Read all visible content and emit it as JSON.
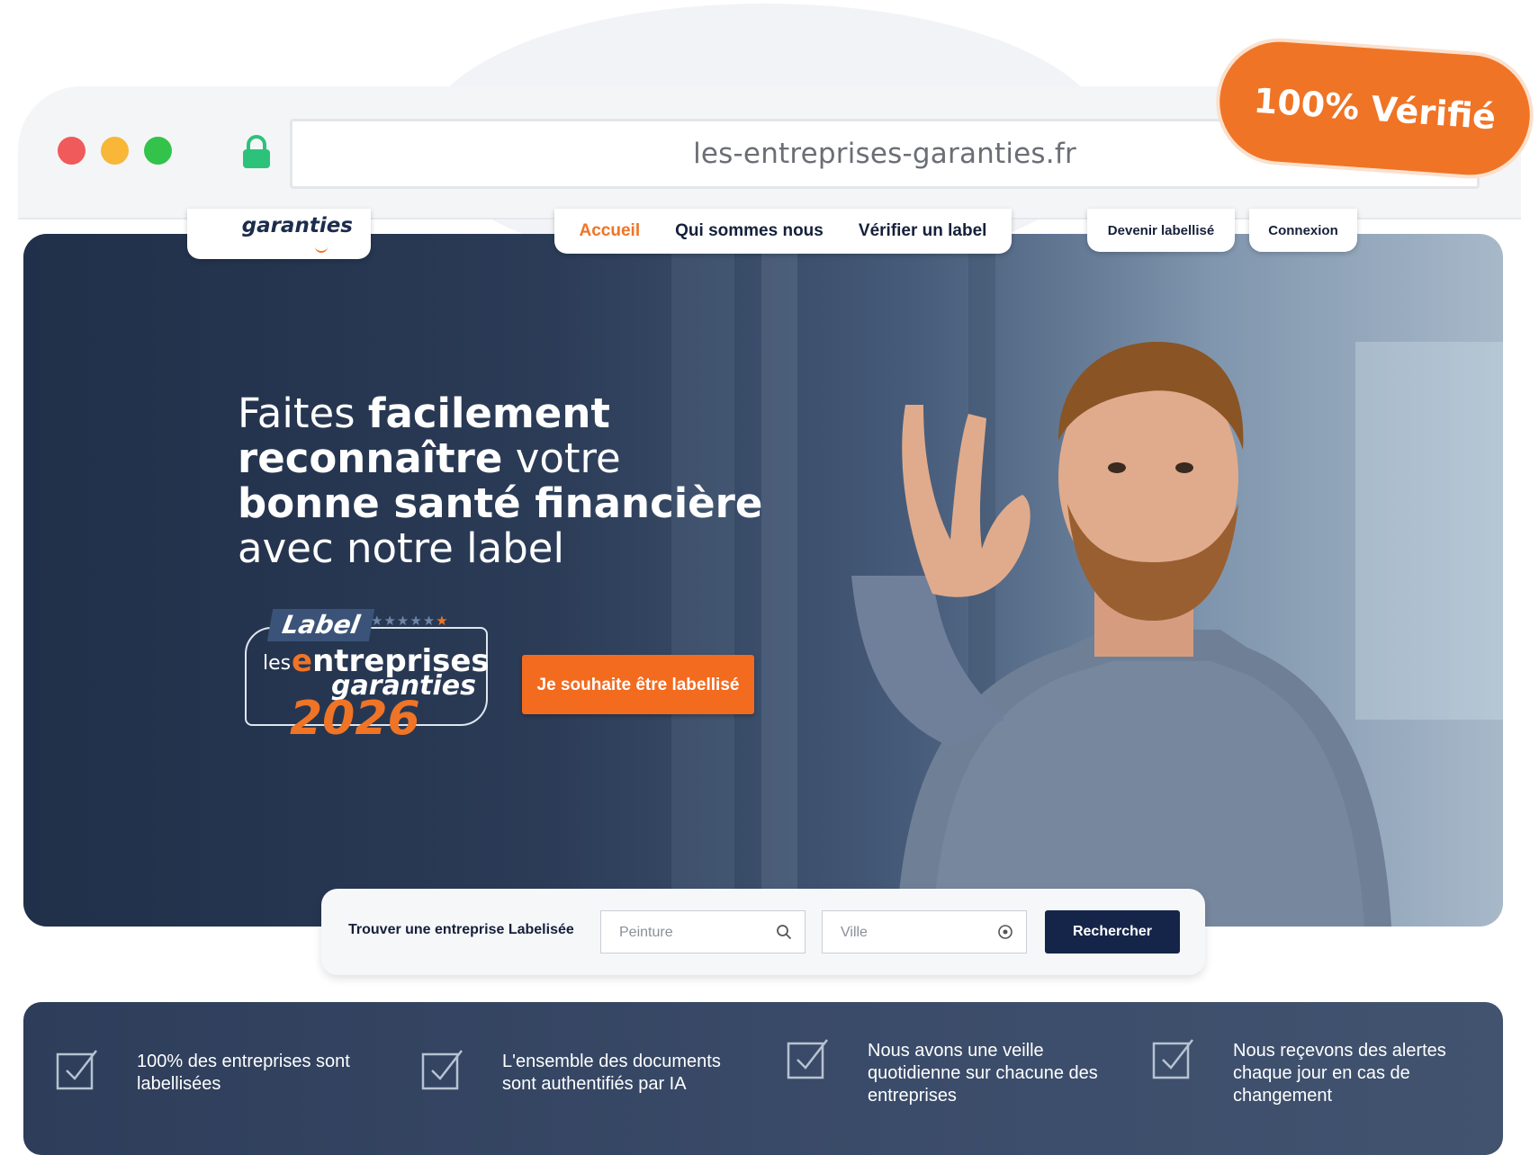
{
  "browser": {
    "url": "les-entreprises-garanties.fr",
    "verified_badge": "100% Vérifié"
  },
  "site": {
    "logo_text": "garanties",
    "nav": {
      "home": "Accueil",
      "about": "Qui sommes nous",
      "verify": "Vérifier un label",
      "become": "Devenir labellisé",
      "login": "Connexion"
    }
  },
  "hero": {
    "headline": {
      "part1": "Faites ",
      "part2": "facilement",
      "part3": "reconnaître",
      "part4": " votre",
      "part5": "bonne santé financière",
      "part6": "avec notre label"
    },
    "label_badge": {
      "tag": "Label",
      "stars": "★★★★★",
      "star_last": "★",
      "les": "les",
      "entreprises_lead": "e",
      "entreprises_rest": "ntreprises",
      "garanties": "garanties",
      "year": "2026"
    },
    "cta": "Je souhaite être labellisé"
  },
  "search": {
    "label": "Trouver une entreprise Labelisée",
    "keyword_placeholder": "Peinture",
    "city_placeholder": "Ville",
    "button": "Rechercher"
  },
  "features": [
    {
      "text": "100% des entreprises sont labellisées"
    },
    {
      "text": "L'ensemble des documents sont authentifiés par IA"
    },
    {
      "text": "Nous avons une veille quotidienne sur chacune des entreprises"
    },
    {
      "text": "Nous reçevons des alertes chaque jour en cas de changement"
    }
  ],
  "colors": {
    "accent": "#f07425",
    "navy": "#15254a",
    "hero_dark": "#25344e"
  }
}
